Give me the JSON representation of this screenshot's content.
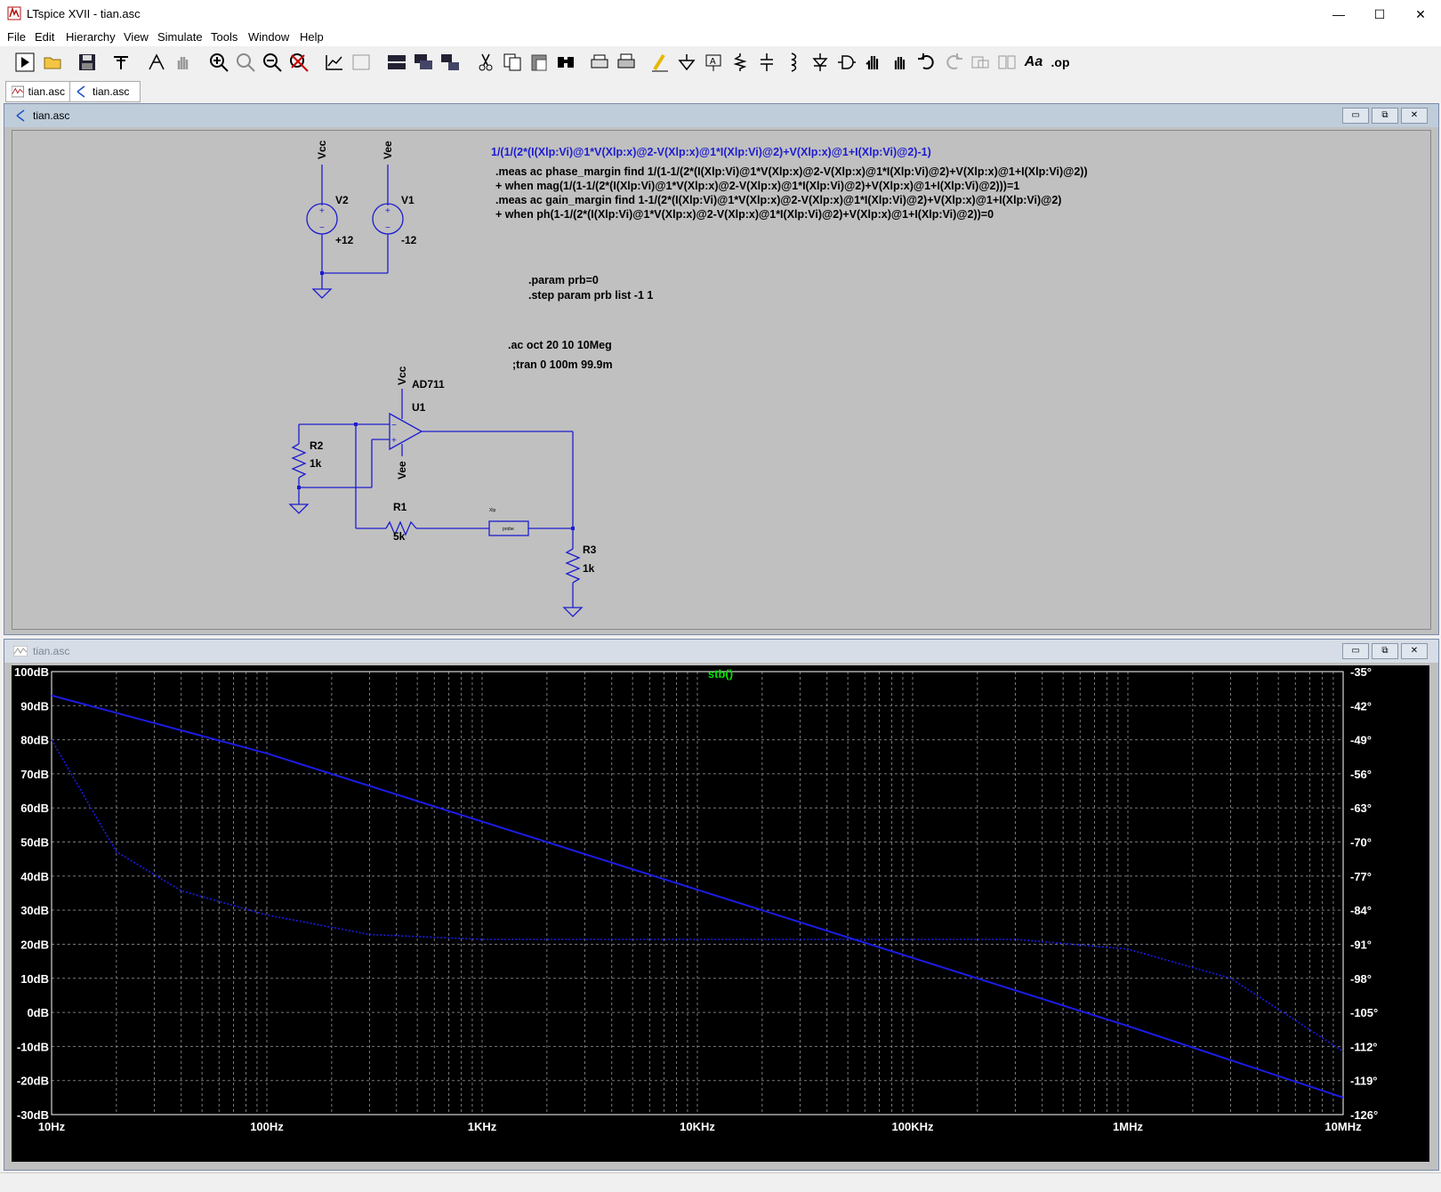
{
  "window": {
    "title": "LTspice XVII - tian.asc",
    "minimize": "—",
    "maximize": "☐",
    "close": "✕"
  },
  "menu": [
    "File",
    "Edit",
    "Hierarchy",
    "View",
    "Simulate",
    "Tools",
    "Window",
    "Help"
  ],
  "toolbar": [
    "run-icon",
    "open-icon",
    "save-icon",
    "control-panel-icon",
    "halt-icon",
    "pan-icon",
    "zoom-in-icon",
    "zoom-area-icon",
    "zoom-out-icon",
    "zoom-cancel-icon",
    "autorange-icon",
    "tile-icon",
    "tile-horizontal-icon",
    "cascade-icon",
    "tile-windows-icon",
    "cut-icon",
    "copy-icon",
    "paste-icon",
    "find-icon",
    "print-icon",
    "print-setup-icon",
    "draw-wire-icon",
    "ground-icon",
    "label-net-icon",
    "resistor-icon",
    "capacitor-icon",
    "inductor-icon",
    "diode-icon",
    "component-icon",
    "move-icon",
    "drag-icon",
    "undo-icon",
    "redo-icon",
    "rotate-icon",
    "mirror-icon",
    "text-icon",
    "spice-directive-icon"
  ],
  "toolbar_text": {
    "text": "Aa",
    "spice": ".op"
  },
  "tabs": [
    {
      "label": "tian.asc",
      "icon": "waveform-icon"
    },
    {
      "label": "tian.asc",
      "icon": "schematic-icon"
    }
  ],
  "schematic": {
    "title": "tian.asc",
    "expr_blue": "1/(1/(2*(I(Xlp:Vi)@1*V(Xlp:x)@2-V(Xlp:x)@1*I(Xlp:Vi)@2)+V(Xlp:x)@1+I(Xlp:Vi)@2)-1)",
    "meas": [
      ".meas ac phase_margin find 1/(1-1/(2*(I(Xlp:Vi)@1*V(Xlp:x)@2-V(Xlp:x)@1*I(Xlp:Vi)@2)+V(Xlp:x)@1+I(Xlp:Vi)@2))",
      "+ when mag(1/(1-1/(2*(I(Xlp:Vi)@1*V(Xlp:x)@2-V(Xlp:x)@1*I(Xlp:Vi)@2)+V(Xlp:x)@1+I(Xlp:Vi)@2)))=1",
      ".meas ac gain_margin find 1-1/(2*(I(Xlp:Vi)@1*V(Xlp:x)@2-V(Xlp:x)@1*I(Xlp:Vi)@2)+V(Xlp:x)@1+I(Xlp:Vi)@2)",
      "+ when ph(1-1/(2*(I(Xlp:Vi)@1*V(Xlp:x)@2-V(Xlp:x)@1*I(Xlp:Vi)@2)+V(Xlp:x)@1+I(Xlp:Vi)@2))=0"
    ],
    "param": [
      ".param prb=0",
      ".step param prb list -1 1"
    ],
    "ac": ".ac oct 20 10 10Meg",
    "tran": ";tran 0 100m 99.9m",
    "labels": {
      "vcc": "Vcc",
      "vee": "Vee",
      "v2": "V2",
      "v1": "V1",
      "v2val": "+12",
      "v1val": "-12",
      "opamp": "AD711",
      "u1": "U1",
      "r1": "R1",
      "r1val": "5k",
      "r2": "R2",
      "r2val": "1k",
      "r3": "R3",
      "r3val": "1k",
      "xlp": "Xlp",
      "probe": "probe"
    }
  },
  "plot": {
    "title": "tian.asc",
    "trace_name": "stb()",
    "trace_color": "#1c1ce6",
    "grid_color": "#7a7a7a",
    "left_ticks": [
      "100dB",
      "90dB",
      "80dB",
      "70dB",
      "60dB",
      "50dB",
      "40dB",
      "30dB",
      "20dB",
      "10dB",
      "0dB",
      "-10dB",
      "-20dB",
      "-30dB"
    ],
    "right_ticks": [
      "-35°",
      "-42°",
      "-49°",
      "-56°",
      "-63°",
      "-70°",
      "-77°",
      "-84°",
      "-91°",
      "-98°",
      "-105°",
      "-112°",
      "-119°",
      "-126°"
    ],
    "x_ticks": [
      "10Hz",
      "100Hz",
      "1KHz",
      "10KHz",
      "100KHz",
      "1MHz",
      "10MHz"
    ]
  },
  "chart_data": {
    "type": "line",
    "title": "stb()",
    "x_scale": "log",
    "xlim": [
      10,
      10000000
    ],
    "ylim_left": [
      -30,
      100
    ],
    "ylim_right": [
      -126,
      -35
    ],
    "xlabel": "",
    "ylabel": "",
    "grid": true,
    "series": [
      {
        "name": "stb()",
        "axis": "left",
        "x": [
          10,
          100,
          1000,
          10000,
          100000,
          1000000,
          10000000
        ],
        "y": [
          93,
          76,
          56,
          36,
          16,
          -4,
          -25
        ]
      },
      {
        "name": "stb()",
        "axis": "right",
        "x": [
          10,
          20,
          40,
          100,
          300,
          1000,
          10000,
          100000,
          300000,
          1000000,
          3000000,
          10000000
        ],
        "y": [
          -49,
          -72,
          -80,
          -85,
          -89,
          -90,
          -90,
          -90,
          -90,
          -92,
          -98,
          -113
        ]
      }
    ]
  }
}
